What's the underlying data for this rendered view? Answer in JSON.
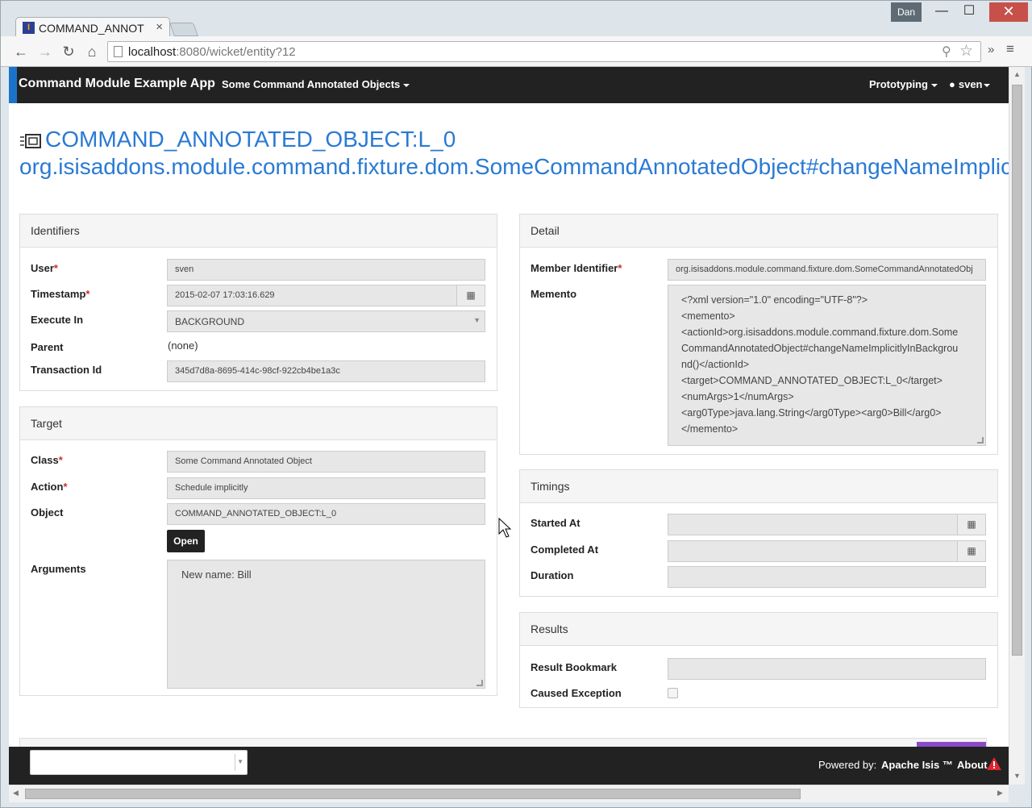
{
  "browser": {
    "tab_title": "COMMAND_ANNOT",
    "user": "Dan",
    "url_host": "localhost",
    "url_rest": ":8080/wicket/entity?12"
  },
  "navbar": {
    "brand": "Command Module Example App",
    "menu": "Some Command Annotated Objects",
    "prototyping": "Prototyping",
    "user": "sven"
  },
  "title": {
    "line1": "COMMAND_ANNOTATED_OBJECT:L_0",
    "line2": "org.isisaddons.module.command.fixture.dom.SomeCommandAnnotatedObject#changeNameImplicitlyInBackground()"
  },
  "identifiers": {
    "heading": "Identifiers",
    "user_label": "User",
    "user": "sven",
    "timestamp_label": "Timestamp",
    "timestamp": "2015-02-07 17:03:16.629",
    "execute_in_label": "Execute In",
    "execute_in": "BACKGROUND",
    "parent_label": "Parent",
    "parent": "(none)",
    "transaction_label": "Transaction Id",
    "transaction": "345d7d8a-8695-414c-98cf-922cb4be1a3c"
  },
  "target": {
    "heading": "Target",
    "class_label": "Class",
    "class": "Some Command Annotated Object",
    "action_label": "Action",
    "action": "Schedule implicitly",
    "object_label": "Object",
    "object": "COMMAND_ANNOTATED_OBJECT:L_0",
    "open_button": "Open",
    "arguments_label": "Arguments",
    "arguments": "New name: Bill"
  },
  "detail": {
    "heading": "Detail",
    "member_label": "Member Identifier",
    "member": "org.isisaddons.module.command.fixture.dom.SomeCommandAnnotatedObj",
    "memento_label": "Memento",
    "memento_lines": [
      "<?xml version=\"1.0\" encoding=\"UTF-8\"?>",
      "<memento>",
      "<actionId>org.isisaddons.module.command.fixture.dom.Some",
      "CommandAnnotatedObject#changeNameImplicitlyInBackgrou",
      "nd()</actionId>",
      "<target>COMMAND_ANNOTATED_OBJECT:L_0</target>",
      "<numArgs>1</numArgs>",
      "<arg0Type>java.lang.String</arg0Type><arg0>Bill</arg0>",
      "</memento>"
    ]
  },
  "timings": {
    "heading": "Timings",
    "started_label": "Started At",
    "started": "",
    "completed_label": "Completed At",
    "completed": "",
    "duration_label": "Duration",
    "duration": ""
  },
  "results": {
    "heading": "Results",
    "bookmark_label": "Result Bookmark",
    "bookmark": "",
    "exception_label": "Caused Exception",
    "exception_checked": false
  },
  "footer": {
    "powered_by": "Powered by:",
    "isis": "Apache Isis ™",
    "about": "About"
  },
  "colors": {
    "link": "#2a7ad4",
    "navbar": "#222222",
    "required": "#c9302c",
    "accent": "#1a73c9",
    "warning": "#e0262e"
  }
}
